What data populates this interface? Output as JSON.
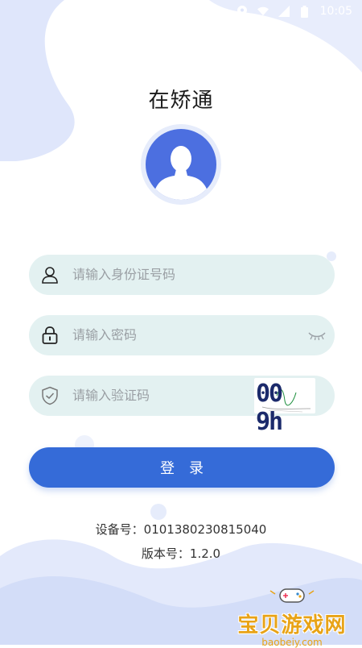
{
  "status_bar": {
    "time": "10:05"
  },
  "app": {
    "title": "在矫通"
  },
  "form": {
    "id_placeholder": "请输入身份证号码",
    "password_placeholder": "请输入密码",
    "captcha_placeholder": "请输入验证码",
    "captcha_text": "00 9h",
    "login_label": "登录"
  },
  "info": {
    "device_label": "设备号：",
    "device_value": "0101380230815040",
    "version_label": "版本号：",
    "version_value": "1.2.0"
  },
  "watermark": {
    "cn": "宝贝游戏网",
    "en": "baobeiy.com"
  },
  "colors": {
    "accent": "#356bd8",
    "field_bg": "#e3f1f1",
    "avatar": "#4c6fe0",
    "blob": "#dfe6fb",
    "watermark": "#e8a317"
  },
  "icons": {
    "id_field": "user-icon",
    "password_field": "lock-icon",
    "password_toggle": "eye-closed-icon",
    "captcha_field": "shield-check-icon"
  }
}
